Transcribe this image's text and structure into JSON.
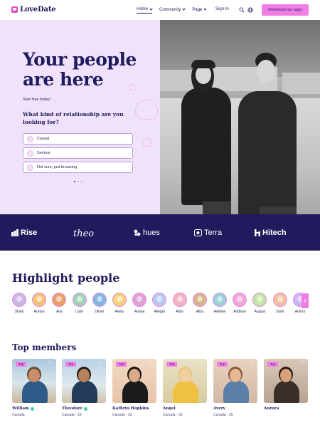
{
  "header": {
    "brand": "LoveDate",
    "nav": [
      {
        "label": "Home",
        "active": true
      },
      {
        "label": "Community",
        "active": false
      },
      {
        "label": "Page",
        "active": false
      }
    ],
    "signin": "Sign In",
    "download": "Download our apps",
    "icons": [
      "search-icon",
      "globe-icon"
    ]
  },
  "hero": {
    "title": "Your people are here",
    "start_free": "Start free today!",
    "question": "What kind of relationship are you looking for?",
    "options": [
      "Casual",
      "Serious",
      "Not sure, just browsing"
    ],
    "slides": 3,
    "active_slide": 1
  },
  "brands": [
    "Rise",
    "theo",
    "hues",
    "Terra",
    "Hitech"
  ],
  "highlight": {
    "title": "Highlight people",
    "people": [
      "Shani",
      "Aurora",
      "Ava",
      "Liam",
      "Oliver",
      "Avery",
      "Ariana",
      "Allegra",
      "Alice",
      "Alba",
      "Adeline",
      "Addison",
      "August",
      "Joinh",
      "Antoni"
    ]
  },
  "members": {
    "title": "Top members",
    "badge": "Top",
    "items": [
      {
        "name": "William",
        "meta": "Canada",
        "verified": true
      },
      {
        "name": "Theodore",
        "meta": "Canada - 19",
        "verified": true
      },
      {
        "name": "Kathrin Hopkins",
        "meta": "Canada - 22",
        "verified": false
      },
      {
        "name": "Angel",
        "meta": "Canada - 33",
        "verified": false
      },
      {
        "name": "Avery",
        "meta": "Canada - 25",
        "verified": false
      },
      {
        "name": "Aurora",
        "meta": "",
        "verified": false
      }
    ]
  },
  "colors": {
    "navy": "#1f1b5c",
    "pink": "#f07ce6",
    "hero_bg": "#f1e2fb"
  }
}
